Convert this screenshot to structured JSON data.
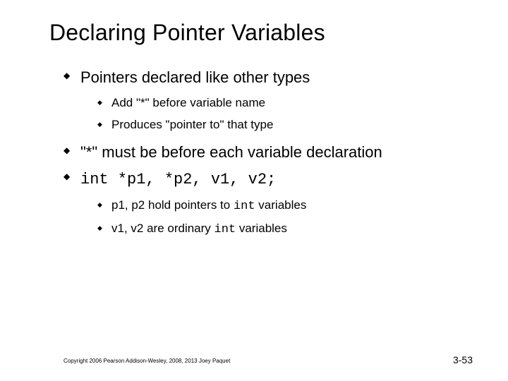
{
  "title": "Declaring Pointer Variables",
  "bullets": {
    "b1": {
      "text": "Pointers declared like other types",
      "sub": {
        "s1": "Add \"*\" before variable name",
        "s2": "Produces \"pointer to\" that type"
      }
    },
    "b2": {
      "text": "\"*\" must be before each variable declaration"
    },
    "b3": {
      "code": "int *p1, *p2, v1, v2;",
      "sub": {
        "s1_pre": "p1, p2 hold pointers to ",
        "s1_code": "int",
        "s1_post": " variables",
        "s2_pre": "v1, v2 are ordinary ",
        "s2_code": "int",
        "s2_post": " variables"
      }
    }
  },
  "footer": {
    "copyright": "Copyright 2006 Pearson Addison-Wesley, 2008, 2013 Joey Paquet",
    "slide_number": "3-53"
  }
}
